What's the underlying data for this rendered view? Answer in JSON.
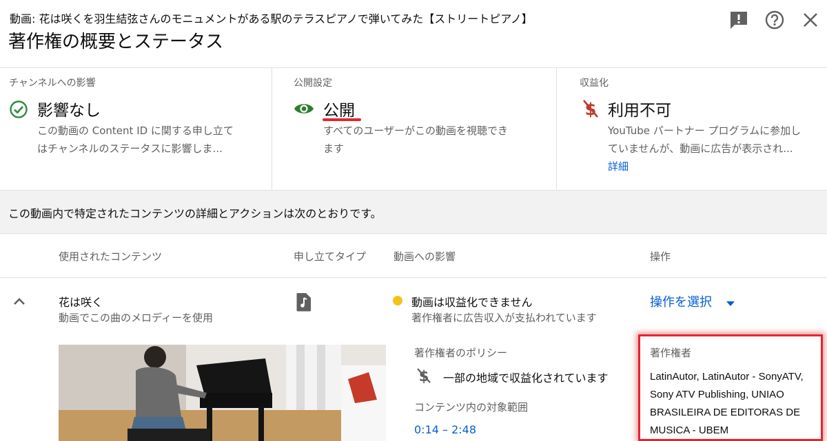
{
  "header": {
    "video_title": "動画: 花は咲くを羽生結弦さんのモニュメントがある駅のテラスピアノで弾いてみた【ストリートピアノ】",
    "page_title": "著作権の概要とステータス"
  },
  "status": {
    "channel": {
      "label": "チャンネルへの影響",
      "value": "影響なし",
      "desc_line1": "この動画の Content ID に関する申し立て",
      "desc_line2": "はチャンネルのステータスに影響しま..."
    },
    "visibility": {
      "label": "公開設定",
      "value": "公開",
      "desc_line1": "すべてのユーザーがこの動画を視聴でき",
      "desc_line2": "ます"
    },
    "monetization": {
      "label": "収益化",
      "value": "利用不可",
      "desc_line1": "YouTube パートナー プログラムに参加し",
      "desc_line2": "ていませんが、動画に広告が表示され...",
      "link": "詳細"
    }
  },
  "intro_text": "この動画内で特定されたコンテンツの詳細とアクションは次のとおりです。",
  "table": {
    "headers": {
      "content": "使用されたコンテンツ",
      "claim_type": "申し立てタイプ",
      "impact": "動画への影響",
      "actions": "操作"
    },
    "row": {
      "song_title": "花は咲く",
      "song_usage": "動画でこの曲のメロディーを使用",
      "impact_title": "動画は収益化できません",
      "impact_desc": "著作権者に広告収入が支払われています",
      "action_label": "操作を選択",
      "policy_label": "著作権者のポリシー",
      "policy_value": "一部の地域で収益化されています",
      "range_label": "コンテンツ内の対象範囲",
      "range_value": "0:14 – 2:48",
      "owner_label": "著作権者",
      "owner_line1": "LatinAutor, LatinAutor - SonyATV,",
      "owner_line2": "Sony ATV Publishing, UNIAO",
      "owner_line3": "BRASILEIRA DE EDITORAS DE",
      "owner_line4": "MUSICA - UBEM"
    }
  },
  "colors": {
    "ok_green": "#2e8b3c",
    "eye_green": "#2e7d32",
    "no_money_red": "#c0392b",
    "warning_yellow": "#f5c21b",
    "link_blue": "#065fd4",
    "highlight_red": "#e3262c"
  },
  "icons": {
    "feedback": "feedback-icon",
    "help": "help-icon",
    "close": "close-icon",
    "check": "check-circle-icon",
    "eye": "eye-icon",
    "no_money": "money-off-icon",
    "music": "music-note-icon",
    "chevron": "chevron-up-icon",
    "dropdown": "dropdown-triangle-icon"
  }
}
